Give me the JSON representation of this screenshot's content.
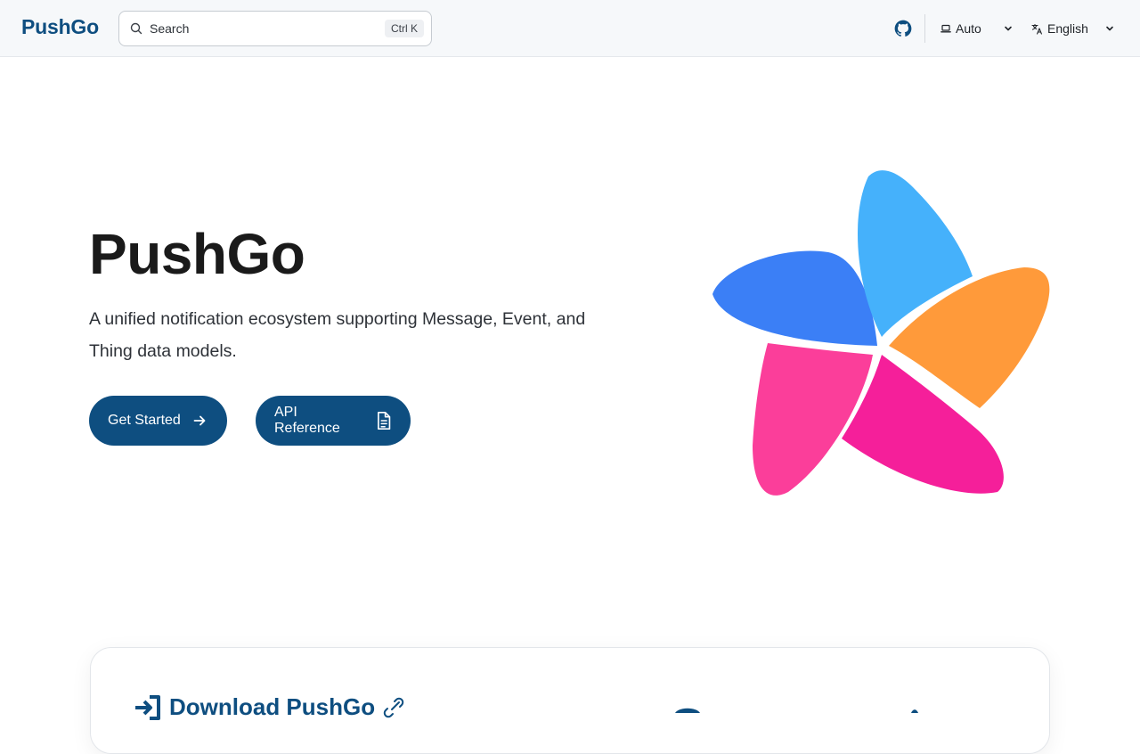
{
  "header": {
    "brand": "PushGo",
    "search_placeholder": "Search",
    "search_shortcut": "Ctrl K",
    "theme_label": "Auto",
    "language_label": "English"
  },
  "hero": {
    "title": "PushGo",
    "subtitle": "A unified notification ecosystem supporting Message, Event, and Thing data models.",
    "primary_button": "Get Started",
    "secondary_button": "API Reference"
  },
  "download_card": {
    "title": "Download PushGo"
  },
  "icons": {
    "search": "search-icon",
    "github": "github-icon",
    "theme": "laptop-icon",
    "language": "translate-icon",
    "chevron": "chevron-down-icon",
    "arrow": "arrow-right-icon",
    "document": "document-icon",
    "download": "sign-in-icon",
    "link": "link-icon"
  },
  "colors": {
    "brand": "#0e4e80",
    "petal_blue": "#3b7ff6",
    "petal_cyan": "#45b1fb",
    "petal_orange": "#ff9a3a",
    "petal_pink": "#f51f9a",
    "petal_magenta": "#fb3e9a"
  }
}
